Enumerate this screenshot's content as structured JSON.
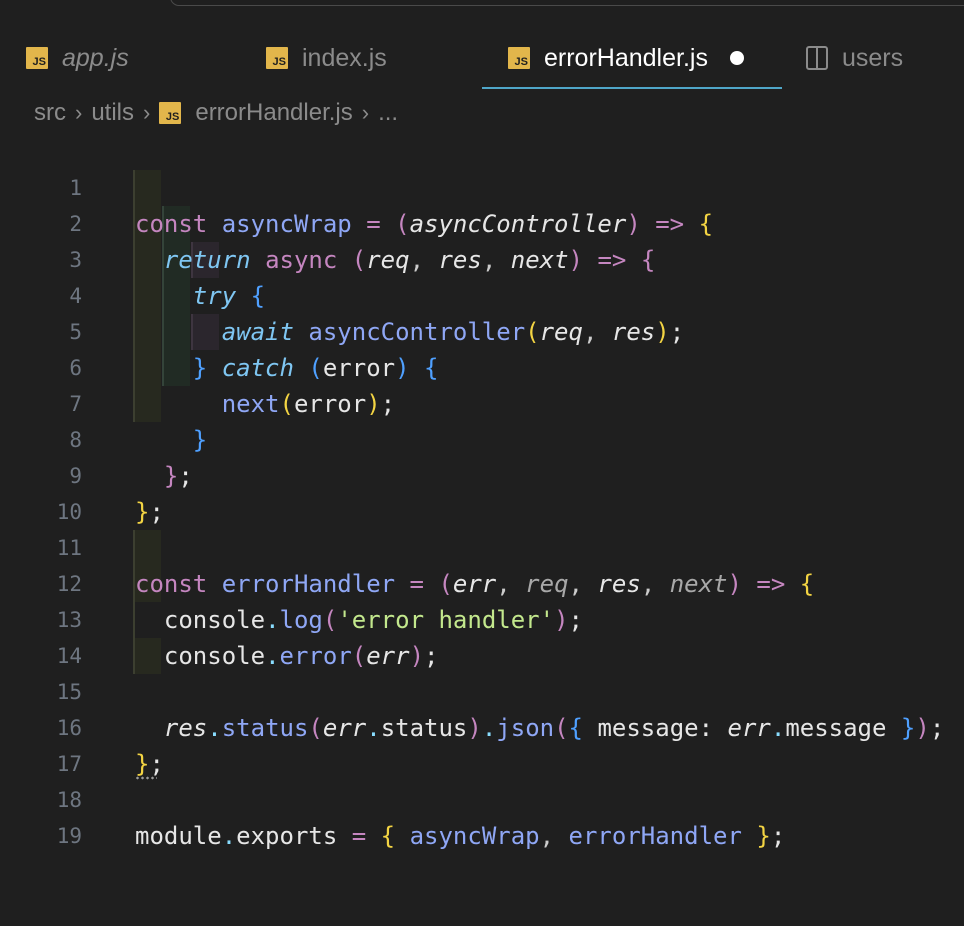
{
  "tabs": [
    {
      "label": "app.js",
      "icon": "js-file-icon",
      "italic": true
    },
    {
      "label": "index.js",
      "icon": "js-file-icon",
      "italic": false
    },
    {
      "label": "errorHandler.js",
      "icon": "js-file-icon",
      "active": true,
      "modified": true
    },
    {
      "label": "users",
      "icon": "preview-split-icon"
    }
  ],
  "breadcrumb": {
    "items": [
      "src",
      "utils",
      "errorHandler.js",
      "..."
    ]
  },
  "line_numbers": [
    "1",
    "2",
    "3",
    "4",
    "5",
    "6",
    "7",
    "8",
    "9",
    "10",
    "11",
    "12",
    "13",
    "14",
    "15",
    "16",
    "17",
    "18",
    "19"
  ],
  "code": {
    "lines": [
      "const asyncWrap = (asyncController) => {",
      "  return async (req, res, next) => {",
      "    try {",
      "      await asyncController(req, res);",
      "    } catch (error) {",
      "      next(error);",
      "    }",
      "  };",
      "};",
      "",
      "const errorHandler = (err, req, res, next) => {",
      "  console.log('error handler');",
      "  console.error(err);",
      "",
      "  res.status(err.status).json({ message: err.message });",
      "};",
      "",
      "module.exports = { asyncWrap, errorHandler };",
      ""
    ]
  },
  "colors": {
    "background": "#1f1f1f",
    "active_tab_underline": "#4fa6c8",
    "js_icon": "#e2b64b",
    "keyword": "#c586c0",
    "function": "#8fa7f5",
    "string": "#c3e88d",
    "bracket_1": "#f3d443",
    "bracket_2": "#c586c0",
    "bracket_3": "#4fa0ff"
  }
}
